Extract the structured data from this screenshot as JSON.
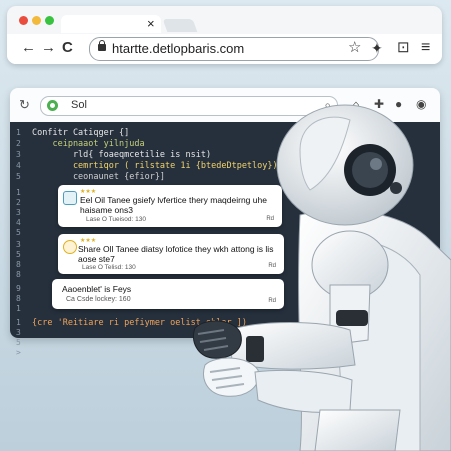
{
  "top_browser": {
    "url": "htartte.detlopbaris.com",
    "tab_close": "×",
    "nav": {
      "back": "←",
      "forward": "→",
      "reload": "C"
    },
    "icons": {
      "star": "☆",
      "extensions": "✦",
      "save": "⊡",
      "menu": "≡"
    },
    "colors": {
      "close_dot": "#ea4d3d",
      "min_dot": "#f3b93a",
      "max_dot": "#39c23f"
    }
  },
  "inner_browser": {
    "search_value": "Sol",
    "icons": {
      "reload": "↻",
      "search": "⌕",
      "home": "⌂",
      "extension": "✚",
      "account": "●",
      "settings": "◉"
    }
  },
  "editor": {
    "line_numbers": [
      "1",
      "2",
      "3",
      "4",
      "5",
      "1",
      "2",
      "3",
      "4",
      "5",
      "3",
      "5",
      "8",
      "8",
      "9",
      "8",
      "1",
      "1",
      "3",
      "5",
      ">"
    ],
    "code_lines": [
      {
        "text": "Confitr Catiqger {]",
        "color": "#e7e7e7"
      },
      {
        "text": "    ceipnaaot yilnjuda",
        "color": "#c5d07a"
      },
      {
        "text": "        rld{ foaeqmcetilie is nsit)",
        "color": "#e7e7e7"
      },
      {
        "text": "        cemrtiqor ( rilstate 1i {btedeDtpetloy})",
        "color": "#f1d36b"
      },
      {
        "text": "        ceonaunet {efior}]",
        "color": "#d0d0d0"
      }
    ],
    "footer_code": "{cre 'Reitiare ri pefiymer oelist eblor ])",
    "footer_code_color": "#f0a35a"
  },
  "cards": [
    {
      "title": "Eel Oil Tanee gsiefy lvfertice thery maqdeirng uhe haisame ons3",
      "meta": "Lase O Tueisod: 130",
      "badge": "Rd",
      "stars": "★★★"
    },
    {
      "title": "Share Oll Tanee diatsy lofotice they wkh attong is lis aose ste7",
      "meta": "Lase O Telisd: 130",
      "badge": "Rd",
      "stars": "★★★"
    },
    {
      "title": "Aaoenblet' is Feys",
      "meta": "Ca Csde lockey: 160",
      "badge": "Rd",
      "stars": ""
    }
  ]
}
